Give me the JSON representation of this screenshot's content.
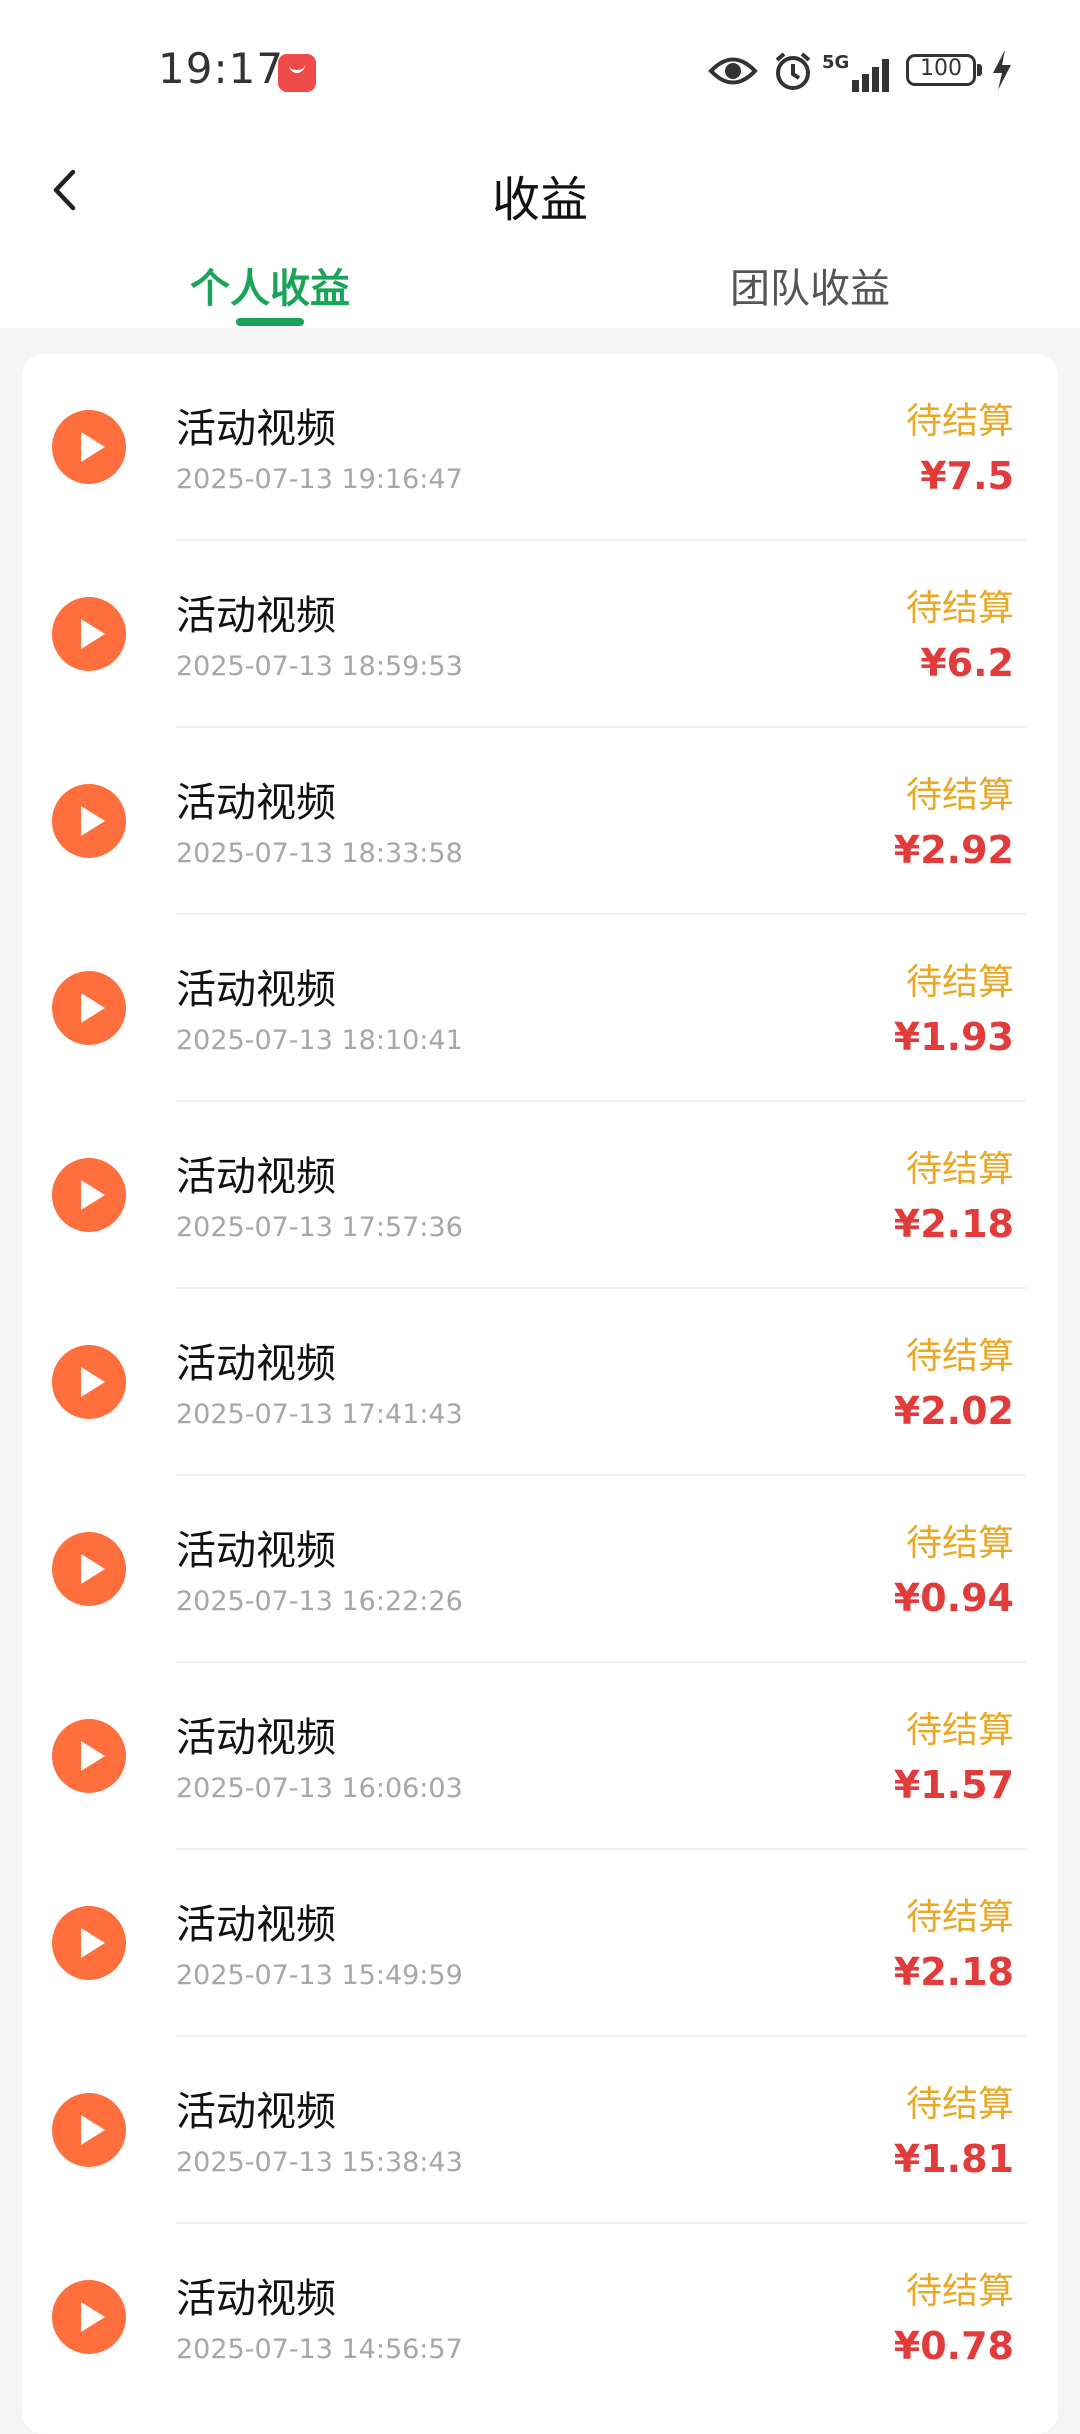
{
  "status_bar": {
    "time": "19:17",
    "battery": "100"
  },
  "header": {
    "title": "收益"
  },
  "tabs": [
    {
      "label": "个人收益",
      "active": true
    },
    {
      "label": "团队收益",
      "active": false
    }
  ],
  "colors": {
    "accent": "#1aa45a",
    "status": "#e9a825",
    "amount": "#e23b3b",
    "play": "#ff6f3d"
  },
  "items": [
    {
      "title": "活动视频",
      "time": "2025-07-13 19:16:47",
      "status": "待结算",
      "amount": "¥7.5"
    },
    {
      "title": "活动视频",
      "time": "2025-07-13 18:59:53",
      "status": "待结算",
      "amount": "¥6.2"
    },
    {
      "title": "活动视频",
      "time": "2025-07-13 18:33:58",
      "status": "待结算",
      "amount": "¥2.92"
    },
    {
      "title": "活动视频",
      "time": "2025-07-13 18:10:41",
      "status": "待结算",
      "amount": "¥1.93"
    },
    {
      "title": "活动视频",
      "time": "2025-07-13 17:57:36",
      "status": "待结算",
      "amount": "¥2.18"
    },
    {
      "title": "活动视频",
      "time": "2025-07-13 17:41:43",
      "status": "待结算",
      "amount": "¥2.02"
    },
    {
      "title": "活动视频",
      "time": "2025-07-13 16:22:26",
      "status": "待结算",
      "amount": "¥0.94"
    },
    {
      "title": "活动视频",
      "time": "2025-07-13 16:06:03",
      "status": "待结算",
      "amount": "¥1.57"
    },
    {
      "title": "活动视频",
      "time": "2025-07-13 15:49:59",
      "status": "待结算",
      "amount": "¥2.18"
    },
    {
      "title": "活动视频",
      "time": "2025-07-13 15:38:43",
      "status": "待结算",
      "amount": "¥1.81"
    },
    {
      "title": "活动视频",
      "time": "2025-07-13 14:56:57",
      "status": "待结算",
      "amount": "¥0.78"
    }
  ]
}
